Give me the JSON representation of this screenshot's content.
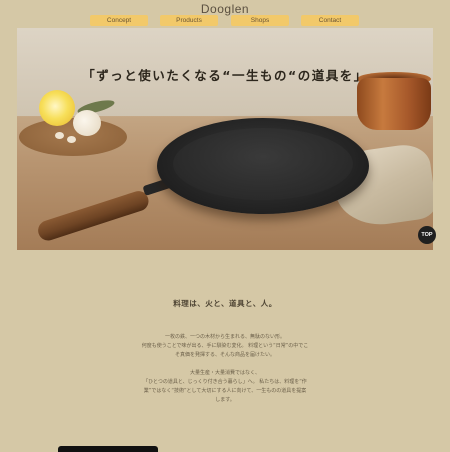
{
  "header": {
    "brand": "Dooglen",
    "nav": [
      {
        "label": "Concept"
      },
      {
        "label": "Products"
      },
      {
        "label": "Shops"
      },
      {
        "label": "Contact"
      }
    ]
  },
  "hero": {
    "tagline": "「ずっと使いたくなる“一生もの“の道具を」",
    "top_button": "TOP"
  },
  "intro": {
    "title": "料理は、火と、道具と、人。",
    "paragraph1": [
      "一枚の鉄、一つの木材から生まれる、無駄のない形。",
      "何度も使うことで味が出る、手に馴染む変化。 料理という“日常”の中でこ",
      "そ真価を発揮する、そんな商品を届けたい。"
    ],
    "paragraph2": [
      "大量生産・大量消費ではなく、",
      "「ひとつの道具と、じっくり付き合う暮らし」へ。 私たちは、料理を“作",
      "業”ではなく“技術”として大切にする人に向けて、一生ものの道具を提案",
      "します。"
    ]
  }
}
